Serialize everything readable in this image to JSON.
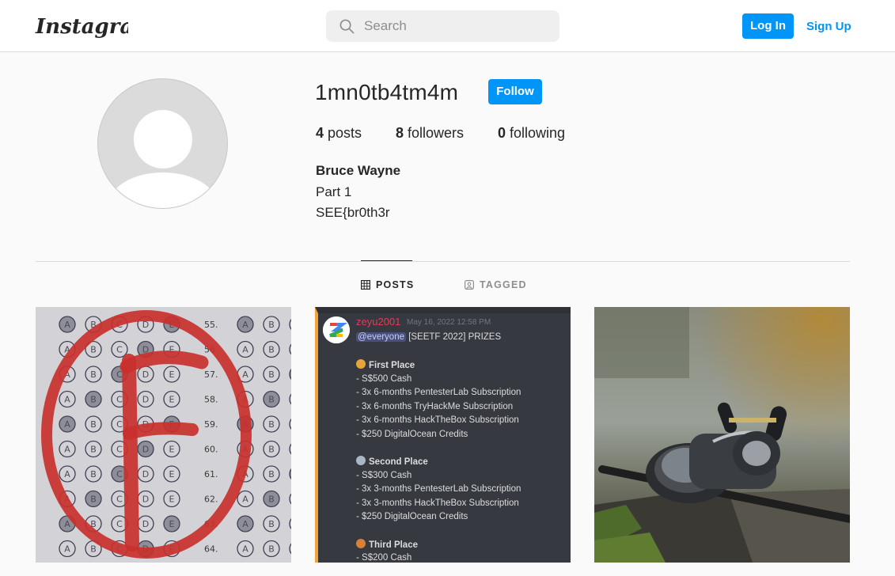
{
  "app": {
    "logo_text": "Instagram",
    "accent": "#0095f6"
  },
  "header": {
    "search_placeholder": "Search",
    "login_label": "Log In",
    "signup_label": "Sign Up"
  },
  "profile": {
    "username": "1mn0tb4tm4m",
    "follow_label": "Follow",
    "stats": {
      "posts_count": "4",
      "posts_label": "posts",
      "followers_count": "8",
      "followers_label": "followers",
      "following_count": "0",
      "following_label": "following"
    },
    "full_name": "Bruce Wayne",
    "bio_lines": [
      "Part 1",
      "SEE{br0th3r"
    ]
  },
  "tabs": [
    {
      "label": "POSTS",
      "icon": "grid-icon",
      "active": true
    },
    {
      "label": "TAGGED",
      "icon": "tag-user-icon",
      "active": false
    }
  ],
  "posts": [
    {
      "subject": "answer-sheet-f-grade",
      "grade_letter": "F",
      "question_numbers": [
        "55.",
        "56.",
        "57.",
        "58.",
        "59.",
        "60.",
        "61.",
        "62.",
        "63.",
        "64."
      ],
      "bubble_letters": [
        "A",
        "B",
        "C",
        "D",
        "E"
      ]
    },
    {
      "subject": "discord-message",
      "username": "zeyu2001",
      "timestamp": "May 16, 2022 12:58 PM",
      "mention": "@everyone",
      "title": "[SEETF 2022] PRIZES",
      "sections": [
        {
          "heading": "First Place",
          "medal_color": "#e8a33d",
          "items": [
            "- S$500 Cash",
            "- 3x 6-months PentesterLab Subscription",
            "- 3x 6-months TryHackMe Subscription",
            "- 3x 6-months HackTheBox Subscription",
            "- $250 DigitalOcean Credits"
          ]
        },
        {
          "heading": "Second Place",
          "medal_color": "#a9b6c6",
          "items": [
            "- S$300 Cash",
            "- 3x 3-months PentesterLab Subscription",
            "- 3x 3-months HackTheBox Subscription",
            "- $250 DigitalOcean Credits"
          ]
        },
        {
          "heading": "Third Place",
          "medal_color": "#d7803a",
          "items": [
            "- S$200 Cash"
          ]
        }
      ]
    },
    {
      "subject": "baitcasting-fishing-reel"
    }
  ]
}
